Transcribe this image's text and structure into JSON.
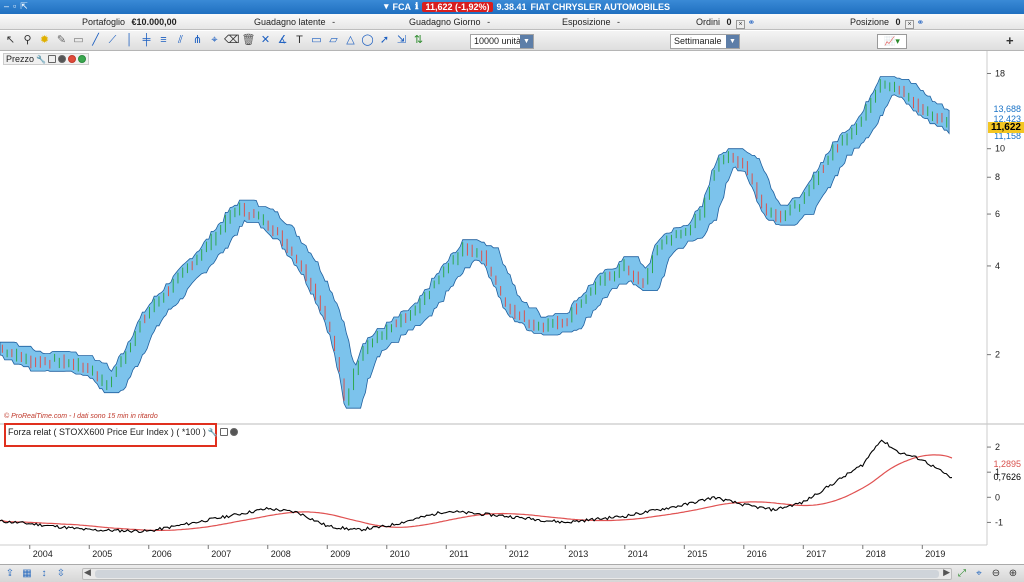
{
  "titlebar": {
    "symbol": "FCA",
    "price_change": "11,622 (-1,92%)",
    "time": "9.38.41",
    "instrument": "FIAT CHRYSLER AUTOMOBILES"
  },
  "infobar": {
    "portafoglio_label": "Portafoglio",
    "portafoglio_value": "€10.000,00",
    "guadagno_latente_label": "Guadagno latente",
    "guadagno_latente_value": "-",
    "guadagno_giorno_label": "Guadagno Giorno",
    "guadagno_giorno_value": "-",
    "esposizione_label": "Esposizione",
    "esposizione_value": "-",
    "ordini_label": "Ordini",
    "ordini_value": "0",
    "posizione_label": "Posizione",
    "posizione_value": "0"
  },
  "toolbar": {
    "quantity": "10000 unità",
    "timeframe": "Settimanale"
  },
  "price_panel": {
    "label": "Prezzo",
    "copyright": "© ProRealTime.com - I dati sono 15 min in ritardo",
    "y_ticks": [
      "18",
      "10",
      "8",
      "6",
      "4",
      "2"
    ],
    "price_tags": [
      {
        "text": "13,688",
        "color": "#1a73c7"
      },
      {
        "text": "12,423",
        "color": "#1a73c7"
      },
      {
        "text": "11,622",
        "color": "#000000",
        "bg": "#f3c622"
      },
      {
        "text": "11,158",
        "color": "#1a73c7"
      }
    ]
  },
  "indicator_panel": {
    "label": "Forza relat ( STOXX600 Price Eur Index ) ( *100 )",
    "y_ticks": [
      "2",
      "1",
      "0",
      "-1"
    ],
    "value_tags": [
      {
        "text": "1,2895",
        "color": "#d9534f"
      },
      {
        "text": "0,7626",
        "color": "#000000"
      }
    ]
  },
  "x_axis": {
    "years": [
      "2004",
      "2005",
      "2006",
      "2007",
      "2008",
      "2009",
      "2010",
      "2011",
      "2012",
      "2013",
      "2014",
      "2015",
      "2016",
      "2017",
      "2018",
      "2019"
    ]
  },
  "colors": {
    "band_fill": "#7cc3ec",
    "band_stroke": "#1f5f9e",
    "up_candle": "#2fa84f",
    "down_candle": "#d9534f",
    "rs_line": "#000000",
    "rs_ma": "#e05252"
  },
  "chart_data": {
    "type": "line",
    "series": [
      {
        "x": [
          2003.5,
          2004.0,
          2004.5,
          2005.0,
          2005.3,
          2005.6,
          2006.0,
          2006.5,
          2007.0,
          2007.5,
          2008.0,
          2008.5,
          2009.0,
          2009.3,
          2009.6,
          2010.0,
          2010.5,
          2011.0,
          2011.3,
          2011.6,
          2012.0,
          2012.5,
          2013.0,
          2013.5,
          2014.0,
          2014.3,
          2014.6,
          2015.0,
          2015.3,
          2015.6,
          2016.0,
          2016.3,
          2016.6,
          2017.0,
          2017.5,
          2018.0,
          2018.3,
          2018.6,
          2019.0,
          2019.5
        ],
        "values": [
          2.1,
          1.9,
          1.9,
          1.8,
          1.55,
          2.0,
          2.8,
          3.6,
          4.7,
          6.3,
          5.6,
          4.2,
          2.6,
          1.35,
          2.1,
          2.4,
          2.8,
          3.9,
          4.6,
          4.4,
          2.9,
          2.5,
          2.6,
          3.4,
          4.0,
          3.4,
          4.8,
          5.2,
          6.0,
          9.4,
          9.0,
          6.4,
          5.9,
          6.6,
          9.8,
          12.6,
          17.0,
          15.8,
          13.5,
          12.0
        ]
      },
      {
        "x": [
          2003.5,
          2004.0,
          2005.0,
          2006.0,
          2007.0,
          2008.0,
          2008.5,
          2009.0,
          2009.5,
          2010.0,
          2011.0,
          2012.0,
          2013.0,
          2014.0,
          2015.0,
          2015.5,
          2016.0,
          2016.5,
          2017.0,
          2017.5,
          2018.0,
          2018.3,
          2018.6,
          2019.0,
          2019.5
        ],
        "values": [
          -0.95,
          -1.05,
          -1.3,
          -1.35,
          -0.9,
          -0.45,
          -0.6,
          -1.15,
          -1.3,
          -1.15,
          -0.55,
          -0.75,
          -1.0,
          -0.75,
          -0.3,
          0.0,
          -0.3,
          -0.5,
          -0.2,
          0.55,
          1.3,
          2.3,
          1.8,
          1.5,
          0.76
        ]
      }
    ],
    "ylim": [
      1.2,
      20
    ],
    "xlim": [
      2003.5,
      2019.6
    ]
  }
}
